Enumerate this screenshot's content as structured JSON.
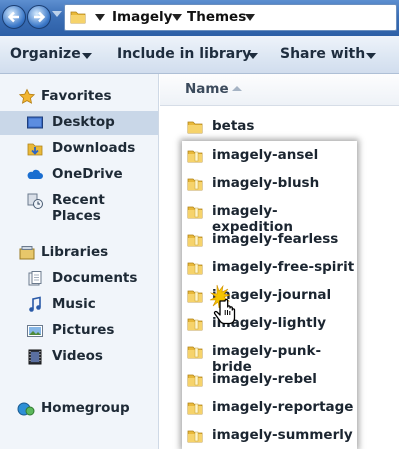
{
  "breadcrumb": {
    "items": [
      "Imagely",
      "Themes"
    ]
  },
  "toolbar": {
    "organize_label": "Organize",
    "include_label": "Include in library",
    "share_label": "Share with"
  },
  "nav": {
    "favorites_label": "Favorites",
    "favorites": [
      {
        "label": "Desktop",
        "icon": "desktop-icon",
        "selected": true
      },
      {
        "label": "Downloads",
        "icon": "downloads-icon"
      },
      {
        "label": "OneDrive",
        "icon": "onedrive-icon"
      },
      {
        "label": "Recent Places",
        "icon": "recent-places-icon"
      }
    ],
    "libraries_label": "Libraries",
    "libraries": [
      {
        "label": "Documents",
        "icon": "documents-icon"
      },
      {
        "label": "Music",
        "icon": "music-icon"
      },
      {
        "label": "Pictures",
        "icon": "pictures-icon"
      },
      {
        "label": "Videos",
        "icon": "videos-icon"
      }
    ],
    "homegroup_label": "Homegroup"
  },
  "list": {
    "column_name": "Name",
    "items": [
      "betas",
      "imagely-ansel",
      "imagely-blush",
      "imagely-expedition",
      "imagely-fearless",
      "imagely-free-spirit",
      "imagely-journal",
      "imagely-lightly",
      "imagely-punk-bride",
      "imagely-rebel",
      "imagely-reportage",
      "imagely-summerly"
    ]
  },
  "colors": {
    "titlebar": "#3b6fb6",
    "toolbar": "#dde7f3",
    "nav_selected": "#c9d7e8",
    "folder_yellow": "#f2c94c"
  }
}
